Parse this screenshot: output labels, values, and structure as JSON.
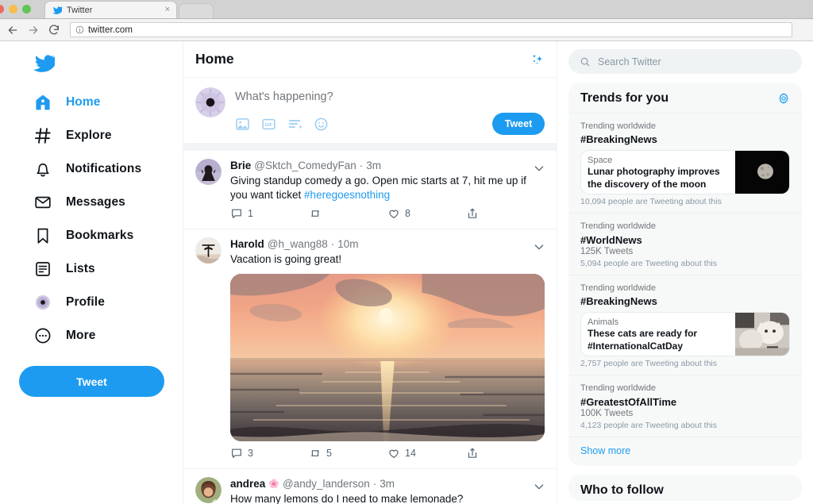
{
  "browser": {
    "tab": {
      "title": "Twitter",
      "favicon": "twitter-bird-icon",
      "close": "×"
    },
    "url": "twitter.com",
    "back_icon": "arrow-left-icon",
    "forward_icon": "arrow-right-icon",
    "reload_icon": "reload-icon",
    "info_icon": "info-circle-icon",
    "lights": [
      "close-red",
      "minimize-yellow",
      "maximize-green"
    ]
  },
  "theme": {
    "accent": "#1d9bf0",
    "text": "#0f1419",
    "muted": "#71767b",
    "panel": "#f7f9f9",
    "divider": "#eff3f4"
  },
  "sidebar": {
    "logo": "twitter-bird-icon",
    "items": [
      {
        "label": "Home",
        "icon": "home-icon",
        "active": true
      },
      {
        "label": "Explore",
        "icon": "hashtag-icon",
        "active": false
      },
      {
        "label": "Notifications",
        "icon": "bell-icon",
        "active": false
      },
      {
        "label": "Messages",
        "icon": "envelope-icon",
        "active": false
      },
      {
        "label": "Bookmarks",
        "icon": "bookmark-icon",
        "active": false
      },
      {
        "label": "Lists",
        "icon": "list-icon",
        "active": false
      },
      {
        "label": "Profile",
        "icon": "profile-avatar-icon",
        "active": false
      },
      {
        "label": "More",
        "icon": "ellipsis-circle-icon",
        "active": false
      }
    ],
    "tweet_button": "Tweet"
  },
  "feed": {
    "header": {
      "title": "Home",
      "sparkles_icon": "sparkles-icon"
    },
    "composer": {
      "placeholder": "What's happening?",
      "avatar": "user-avatar",
      "tools": [
        {
          "icon": "image-icon",
          "name": "add-image"
        },
        {
          "icon": "gif-icon",
          "name": "add-gif"
        },
        {
          "icon": "poll-icon",
          "name": "add-poll"
        },
        {
          "icon": "emoji-icon",
          "name": "add-emoji"
        }
      ],
      "tweet_button": "Tweet"
    },
    "tweets": [
      {
        "name": "Brie",
        "badge": "",
        "handle": "@Sktch_ComedyFan",
        "dot": "·",
        "time": "3m",
        "text": "Giving standup comedy a go. Open mic starts at 7, hit me up if you want ticket ",
        "hashtag": "#heregoesnothing",
        "media": null,
        "actions": {
          "replies": "1",
          "retweets": "",
          "likes": "8",
          "share": ""
        }
      },
      {
        "name": "Harold",
        "badge": "",
        "handle": "@h_wang88",
        "dot": "·",
        "time": "10m",
        "text": "Vacation is going great!",
        "hashtag": "",
        "media": "sunset-ocean-photo",
        "actions": {
          "replies": "3",
          "retweets": "5",
          "likes": "14",
          "share": ""
        }
      },
      {
        "name": "andrea",
        "badge": "🌸",
        "handle": "@andy_landerson",
        "dot": "·",
        "time": "3m",
        "text": "How many lemons do I need to make lemonade?",
        "hashtag": "",
        "media": null,
        "actions": {
          "replies": "",
          "retweets": "",
          "likes": "",
          "share": ""
        }
      }
    ]
  },
  "right": {
    "search": {
      "placeholder": "Search Twitter",
      "icon": "search-icon"
    },
    "trends_card": {
      "title": "Trends for you",
      "settings_icon": "gear-icon",
      "show_more": "Show more",
      "trends": [
        {
          "category": "Trending worldwide",
          "tag": "#BreakingNews",
          "tweet_count": "",
          "meta": "10,094 people are Tweeting about this",
          "promo": {
            "category": "Space",
            "title": "Lunar photography improves the discovery of the moon",
            "image": "moon-photo"
          }
        },
        {
          "category": "Trending worldwide",
          "tag": "#WorldNews",
          "tweet_count": "125K Tweets",
          "meta": "5,094 people are Tweeting about this",
          "promo": null
        },
        {
          "category": "Trending worldwide",
          "tag": "#BreakingNews",
          "tweet_count": "",
          "meta": "2,757 people are Tweeting about this",
          "promo": {
            "category": "Animals",
            "title": "These cats are ready for #InternationalCatDay",
            "image": "cats-photo"
          }
        },
        {
          "category": "Trending worldwide",
          "tag": "#GreatestOfAllTime",
          "tweet_count": "100K Tweets",
          "meta": "4,123 people are Tweeting about this",
          "promo": null
        }
      ]
    },
    "who_to_follow": {
      "title": "Who to follow"
    }
  }
}
